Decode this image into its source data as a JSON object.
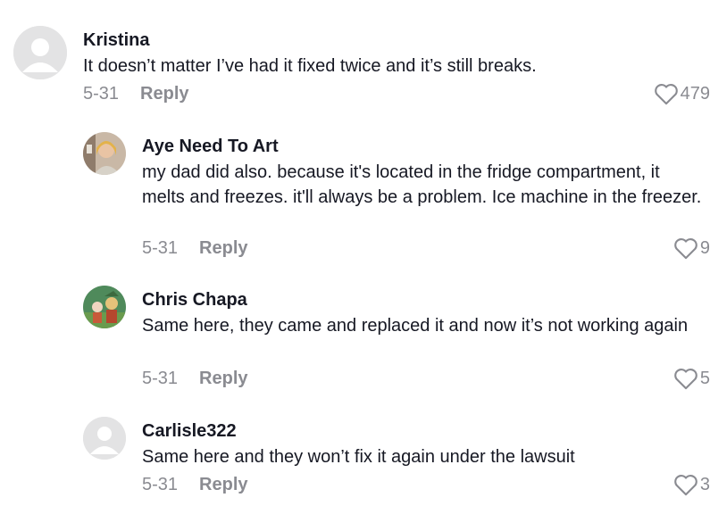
{
  "comments": [
    {
      "username": "Kristina",
      "text": "It doesn’t matter I’ve had it fixed twice and it’s still breaks.",
      "date": "5-31",
      "reply_label": "Reply",
      "likes": "479",
      "avatar": "default-avatar-icon"
    },
    {
      "username": "Aye Need To Art",
      "text": "my dad did also. because it's located in the fridge compartment, it melts and freezes. it'll always be a problem. Ice machine in the freezer.",
      "date": "5-31",
      "reply_label": "Reply",
      "likes": "9",
      "avatar": "profile-photo"
    },
    {
      "username": "Chris Chapa",
      "text": "Same here, they came and replaced it and now it’s not working again",
      "date": "5-31",
      "reply_label": "Reply",
      "likes": "5",
      "avatar": "profile-photo"
    },
    {
      "username": "Carlisle322",
      "text": "Same here and they won’t fix it again under the lawsuit",
      "date": "5-31",
      "reply_label": "Reply",
      "likes": "3",
      "avatar": "default-avatar-icon"
    }
  ],
  "colors": {
    "text": "#161823",
    "muted": "#8a8b91",
    "avatar_bg": "#e3e3e4"
  }
}
